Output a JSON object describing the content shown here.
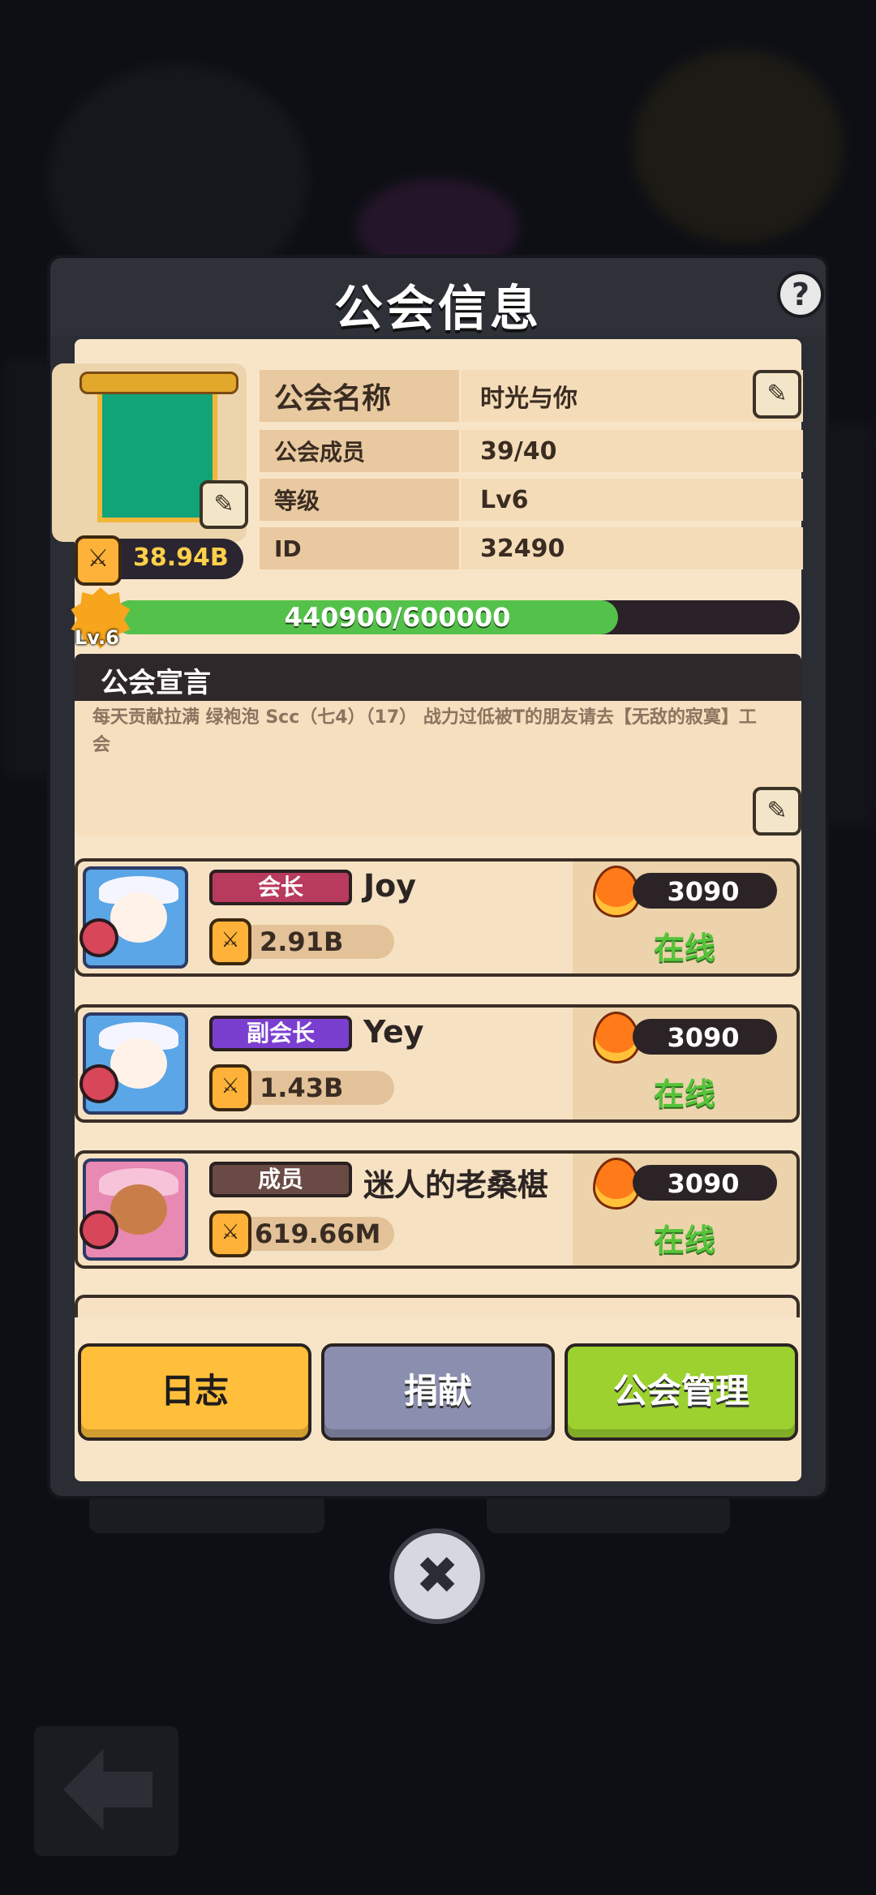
{
  "dialog": {
    "title": "公会信息",
    "help_icon": "?"
  },
  "guild": {
    "power": "38.94B",
    "info": [
      {
        "label": "公会名称",
        "value": "时光与你"
      },
      {
        "label": "公会成员",
        "value": "39/40"
      },
      {
        "label": "等级",
        "value": "Lv6"
      },
      {
        "label": "ID",
        "value": "32490"
      }
    ],
    "xp_text": "440900/600000",
    "xp_progress": 0.735,
    "level_badge": "Lv.6"
  },
  "declaration": {
    "title": "公会宣言",
    "text": "每天贡献拉满  绿袍泡 Scc（七4）（17）  战力过低被T的朋友请去【无敌的寂寞】工会"
  },
  "members": [
    {
      "role": "会长",
      "role_color": "#b83a5c",
      "name": "Joy",
      "power": "2.91B",
      "activity": "3090",
      "status": "在线"
    },
    {
      "role": "副会长",
      "role_color": "#7b3fd0",
      "name": "Yey",
      "power": "1.43B",
      "activity": "3090",
      "status": "在线"
    },
    {
      "role": "成员",
      "role_color": "#6a4a44",
      "name": "迷人的老桑椹",
      "power": "619.66M",
      "activity": "3090",
      "status": "在线"
    }
  ],
  "buttons": {
    "log": "日志",
    "donate": "捐献",
    "manage": "公会管理"
  },
  "icons": {
    "close": "✖",
    "edit": "✎",
    "sword": "⚔"
  }
}
